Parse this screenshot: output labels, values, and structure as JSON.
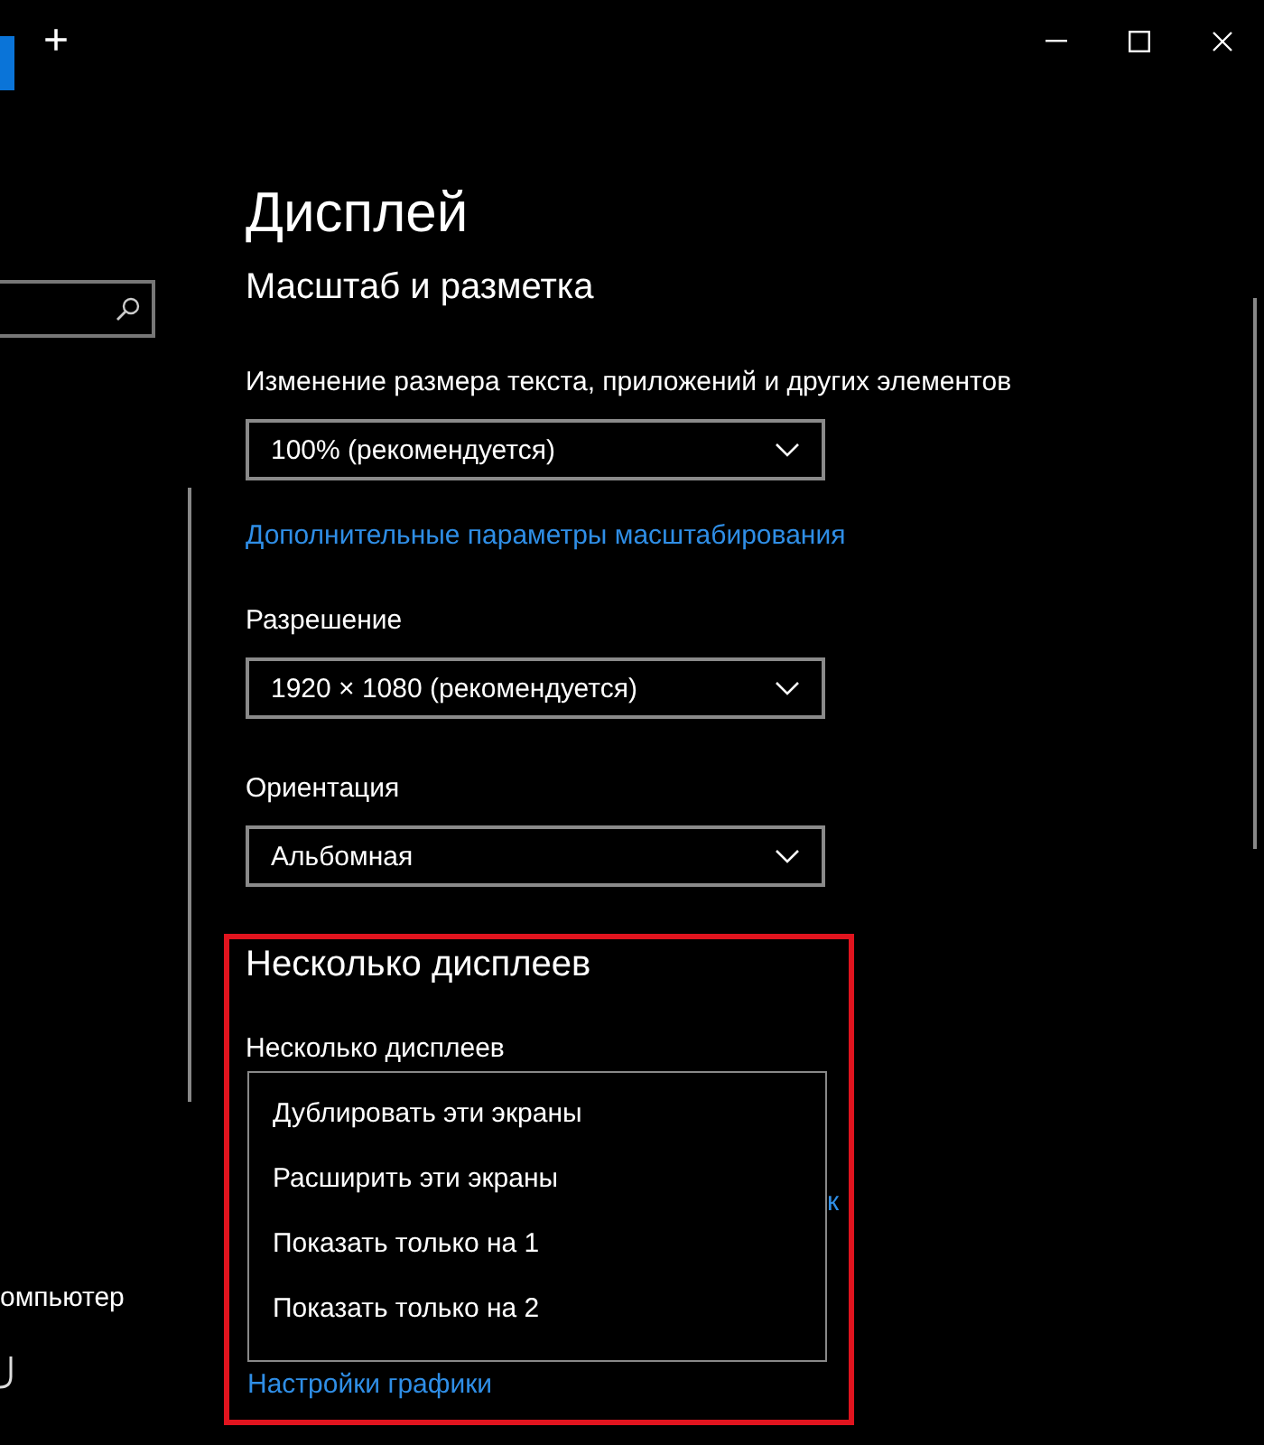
{
  "titlebar": {
    "new_tab": "+"
  },
  "sidebar": {
    "items": [
      {
        "label": "омпьютер"
      }
    ]
  },
  "page": {
    "title": "Дисплей",
    "section": "Масштаб и разметка",
    "settings": [
      {
        "label": "Изменение размера текста, приложений и других элементов",
        "value": "100% (рекомендуется)"
      },
      {
        "link": "Дополнительные параметры масштабирования"
      },
      {
        "label": "Разрешение",
        "value": "1920 × 1080 (рекомендуется)"
      },
      {
        "label": "Ориентация",
        "value": "Альбомная"
      }
    ]
  },
  "multi": {
    "heading": "Несколько дисплеев",
    "label": "Несколько дисплеев",
    "link_fragment": "к",
    "options": [
      {
        "label": "Дублировать эти экраны"
      },
      {
        "label": "Расширить эти экраны"
      },
      {
        "label": "Показать только на 1"
      },
      {
        "label": "Показать только на 2"
      }
    ],
    "bottom_link": "Настройки графики"
  }
}
